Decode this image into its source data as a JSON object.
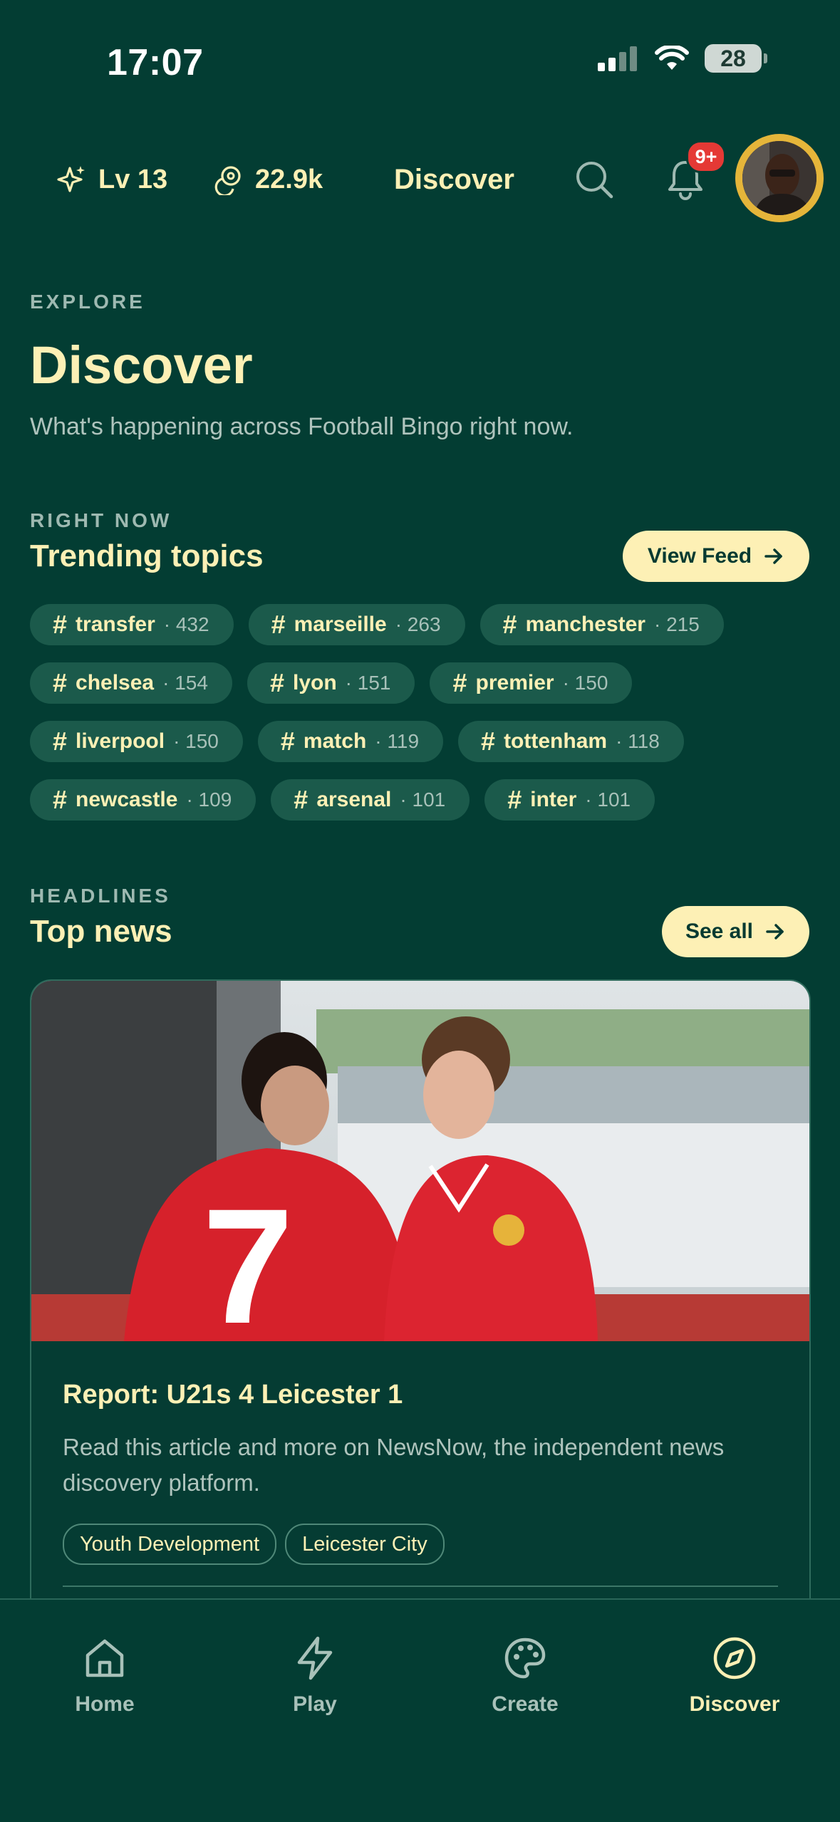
{
  "status_bar": {
    "time": "17:07",
    "battery": "28"
  },
  "top_bar": {
    "level": "Lv 13",
    "coins": "22.9k",
    "title": "Discover",
    "notifications_badge": "9+"
  },
  "header": {
    "eyebrow": "EXPLORE",
    "title": "Discover",
    "subtitle": "What's happening across Football Bingo right now."
  },
  "trending": {
    "eyebrow": "RIGHT NOW",
    "title": "Trending topics",
    "action_label": "View Feed",
    "rows": [
      [
        {
          "tag": "transfer",
          "count": "· 432"
        },
        {
          "tag": "marseille",
          "count": "· 263"
        },
        {
          "tag": "manchester",
          "count": "· 215"
        }
      ],
      [
        {
          "tag": "chelsea",
          "count": "· 154"
        },
        {
          "tag": "lyon",
          "count": "· 151"
        },
        {
          "tag": "premier",
          "count": "· 150"
        }
      ],
      [
        {
          "tag": "liverpool",
          "count": "· 150"
        },
        {
          "tag": "match",
          "count": "· 119"
        },
        {
          "tag": "tottenham",
          "count": "· 118"
        }
      ],
      [
        {
          "tag": "newcastle",
          "count": "· 109"
        },
        {
          "tag": "arsenal",
          "count": "· 101"
        },
        {
          "tag": "inter",
          "count": "· 101"
        }
      ]
    ]
  },
  "news": {
    "eyebrow": "HEADLINES",
    "title": "Top news",
    "action_label": "See all",
    "card": {
      "headline": "Report: U21s 4 Leicester 1",
      "body": "Read this article and more on NewsNow, the independent news discovery platform.",
      "tags": [
        "Youth Development",
        "Leicester City"
      ]
    }
  },
  "bottom_nav": [
    {
      "label": "Home",
      "icon": "home-icon",
      "active": false
    },
    {
      "label": "Play",
      "icon": "lightning-icon",
      "active": false
    },
    {
      "label": "Create",
      "icon": "palette-icon",
      "active": false
    },
    {
      "label": "Discover",
      "icon": "compass-icon",
      "active": true
    }
  ],
  "colors": {
    "background": "#033D33",
    "accent": "#FDF0B5",
    "chip": "#1B5A4B",
    "badge": "#E53935",
    "avatar_ring": "#E5B53A"
  }
}
